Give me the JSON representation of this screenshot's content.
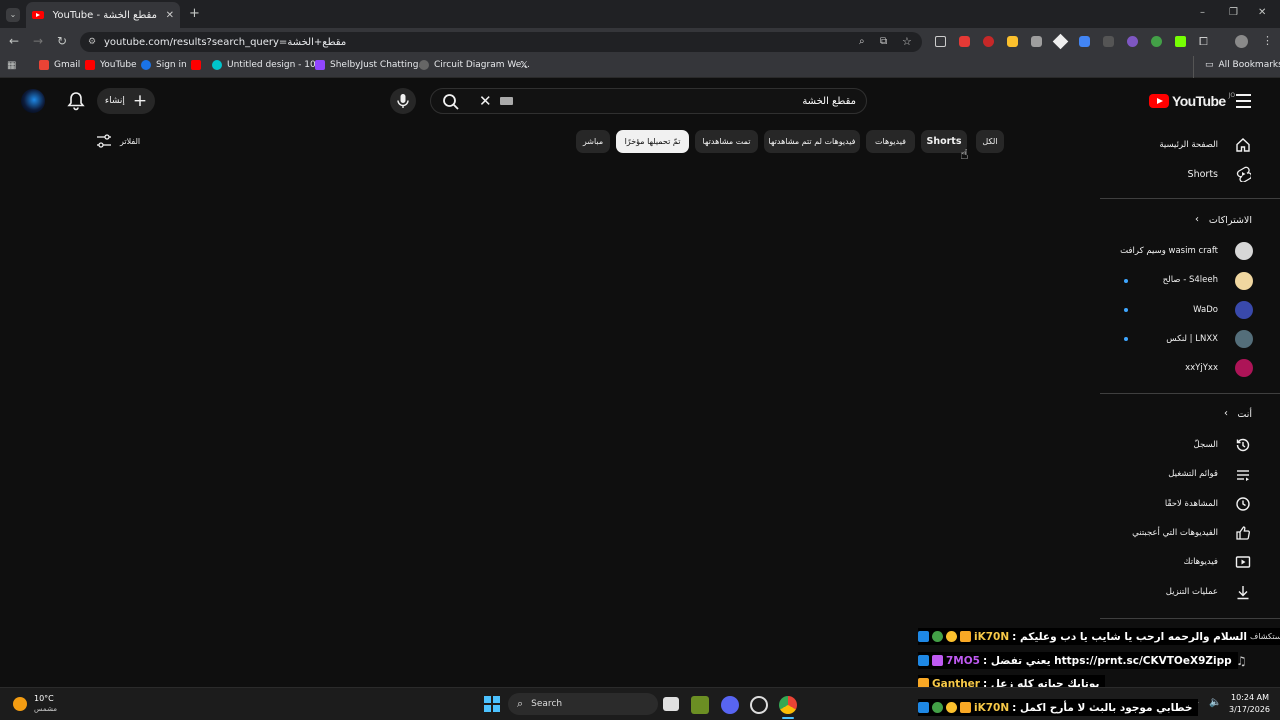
{
  "browser": {
    "tab_title": "YouTube - مقطع الخشة",
    "url": "youtube.com/results?search_query=مقطع+الخشة",
    "bookmarks": [
      {
        "label": "Gmail",
        "color": "#ea4335"
      },
      {
        "label": "YouTube",
        "color": "#ff0000"
      },
      {
        "label": "Sign in",
        "color": "#1a73e8"
      },
      {
        "label": "",
        "color": "#ff0000"
      },
      {
        "label": "Untitled design - 10...",
        "color": "#00c4cc"
      },
      {
        "label": "ShelbyJust Chatting...",
        "color": "#9146ff"
      },
      {
        "label": "Circuit Diagram We...",
        "color": "#666666"
      },
      {
        "label": "",
        "color": "#ffffff"
      }
    ],
    "all_bookmarks": "All Bookmarks"
  },
  "youtube": {
    "logo_text": "YouTube",
    "logo_region": "JO",
    "search_value": "مقطع الخشة",
    "create_label": "إنشاء",
    "filters_label": "الفلاتر",
    "chips": [
      "الكل",
      "Shorts",
      "فيديوهات",
      "فيديوهات لم تتم مشاهدتها",
      "تمت مشاهدتها",
      "تمّ تحميلها مؤخرًا",
      "مباشر"
    ],
    "sidebar": {
      "home": "الصفحة الرئيسية",
      "shorts": "Shorts",
      "subscriptions": "الاشتراكات",
      "channels": [
        {
          "name": "وسيم كرافت wasim craft",
          "dot": false
        },
        {
          "name": "صالح - S4leeh",
          "dot": true
        },
        {
          "name": "WaDo",
          "dot": true
        },
        {
          "name": "لنكس | LNXX",
          "dot": true
        },
        {
          "name": "xxYjYxx",
          "dot": false
        }
      ],
      "you": "أنت",
      "you_items": [
        "السجلّ",
        "قوائم التشغيل",
        "المشاهدة لاحقًا",
        "الفيديوهات التي أعجبتني",
        "فيديوهاتك",
        "عمليات التنزيل"
      ]
    }
  },
  "chat": [
    {
      "user": "iK70N",
      "user_color": "#f7c948",
      "text": ": السلام والرحمه ارحب يا شايب يا دب وعليكم",
      "suffix": "استكشاف"
    },
    {
      "user": "7MO5",
      "user_color": "#bf5af2",
      "text": ": يعني تفضل https://prnt.sc/CKVTOeX9Zipp",
      "suffix": ""
    },
    {
      "user": "Ganther",
      "user_color": "#f7c948",
      "text": ": يوتايك حياته كله زعل",
      "suffix": ""
    },
    {
      "user": "iK70N",
      "user_color": "#f7c948",
      "text": ": خطابي موجود بالبث لا مأرح اكمل",
      "suffix": ""
    }
  ],
  "taskbar": {
    "weather_temp": "10°C",
    "weather_desc": "مشمس",
    "search_label": "Search",
    "time": "10:24 AM",
    "date": "3/17/2026"
  }
}
